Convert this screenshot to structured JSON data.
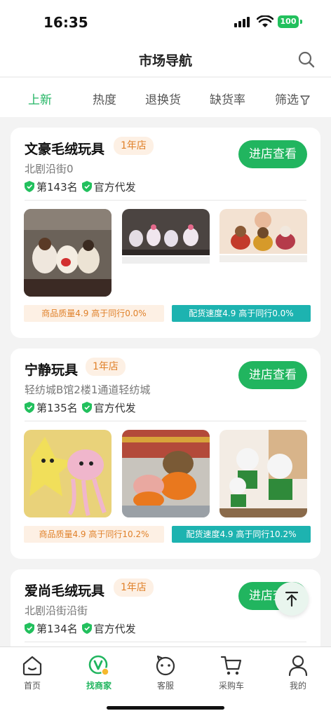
{
  "status": {
    "time": "16:35",
    "battery": "100"
  },
  "nav": {
    "title": "市场导航"
  },
  "tabs": [
    {
      "label": "上新",
      "active": true
    },
    {
      "label": "热度"
    },
    {
      "label": "退换货"
    },
    {
      "label": "缺货率"
    },
    {
      "label": "筛选"
    }
  ],
  "stores": [
    {
      "name": "文豪毛绒玩具",
      "badge": "1年店",
      "address": "北剧沿街0",
      "rank": "第143名",
      "tag": "官方代发",
      "button": "进店查看",
      "quality": "商品质量4.9  高于同行0.0%",
      "speed": "配货速度4.9 高于同行0.0%"
    },
    {
      "name": "宁静玩具",
      "badge": "1年店",
      "address": "轻纺城B馆2楼1通道轻纺城",
      "rank": "第135名",
      "tag": "官方代发",
      "button": "进店查看",
      "quality": "商品质量4.9  高于同行10.2%",
      "speed": "配货速度4.9 高于同行10.2%"
    },
    {
      "name": "爱尚毛绒玩具",
      "badge": "1年店",
      "address": "北剧沿街沿街",
      "rank": "第134名",
      "tag": "官方代发",
      "button": "进店查看"
    }
  ],
  "bottom_nav": [
    {
      "label": "首页",
      "icon": "home-icon"
    },
    {
      "label": "找商家",
      "icon": "find-merchant-icon",
      "active": true
    },
    {
      "label": "客服",
      "icon": "customer-service-icon"
    },
    {
      "label": "采购车",
      "icon": "cart-icon"
    },
    {
      "label": "我的",
      "icon": "profile-icon"
    }
  ],
  "colors": {
    "accent": "#21b55f",
    "badge_text": "#e0812a",
    "badge_bg": "#fdf0e4",
    "teal": "#1db3b0"
  }
}
